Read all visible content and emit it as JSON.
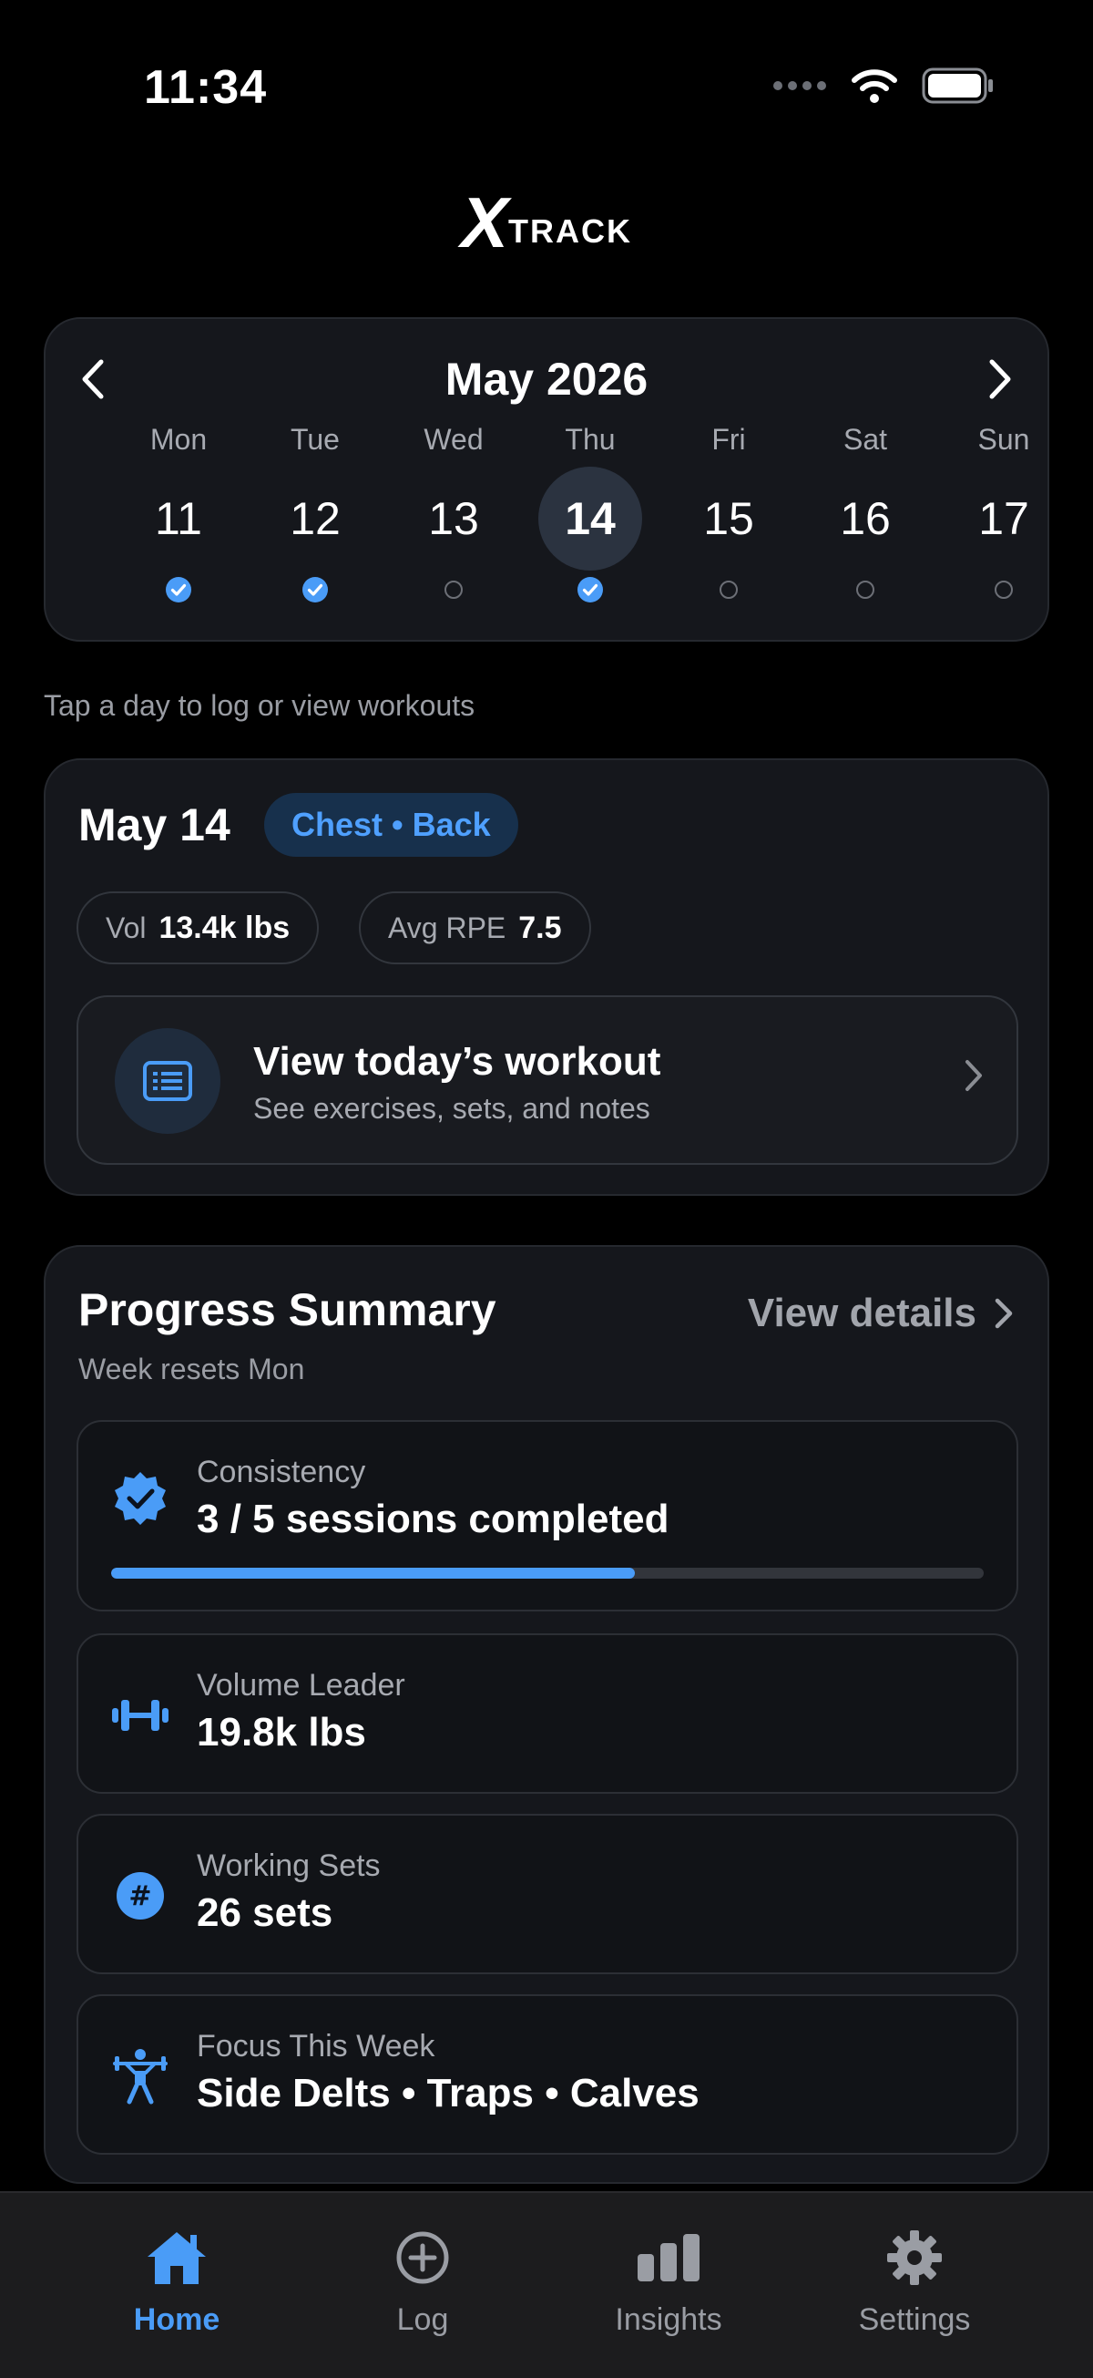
{
  "status_bar": {
    "time": "11:34"
  },
  "app": {
    "logo_mark": "X",
    "logo_text": "TRACK"
  },
  "calendar": {
    "month_label": "May 2026",
    "days": [
      {
        "weekday": "Mon",
        "date": "11",
        "done": true,
        "selected": false
      },
      {
        "weekday": "Tue",
        "date": "12",
        "done": true,
        "selected": false
      },
      {
        "weekday": "Wed",
        "date": "13",
        "done": false,
        "selected": false
      },
      {
        "weekday": "Thu",
        "date": "14",
        "done": true,
        "selected": true
      },
      {
        "weekday": "Fri",
        "date": "15",
        "done": false,
        "selected": false
      },
      {
        "weekday": "Sat",
        "date": "16",
        "done": false,
        "selected": false
      },
      {
        "weekday": "Sun",
        "date": "17",
        "done": false,
        "selected": false
      }
    ],
    "hint": "Tap a day to log or view workouts"
  },
  "day_card": {
    "title": "May 14",
    "tag": "Chest • Back",
    "volume_label": "Vol",
    "volume_value": "13.4k lbs",
    "rpe_label": "Avg RPE",
    "rpe_value": "7.5",
    "workout_title": "View today’s workout",
    "workout_subtitle": "See exercises, sets, and notes"
  },
  "progress": {
    "title": "Progress Summary",
    "link": "View details",
    "subtitle": "Week resets Mon",
    "consistency_label": "Consistency",
    "consistency_value": "3 / 5 sessions completed",
    "consistency_progress": 0.6,
    "volume_leader_label": "Volume Leader",
    "volume_leader_value": "19.8k lbs",
    "sets_label": "Working Sets",
    "sets_value": "26 sets",
    "focus_label": "Focus This Week",
    "focus_value": "Side Delts • Traps • Calves"
  },
  "tabbar": {
    "items": [
      {
        "label": "Home",
        "icon": "home-icon",
        "active": true
      },
      {
        "label": "Log",
        "icon": "plus-circle-icon",
        "active": false
      },
      {
        "label": "Insights",
        "icon": "bar-chart-icon",
        "active": false
      },
      {
        "label": "Settings",
        "icon": "gear-icon",
        "active": false
      }
    ]
  },
  "colors": {
    "accent": "#4a9cf7",
    "background": "#000000",
    "card": "#15171c"
  }
}
